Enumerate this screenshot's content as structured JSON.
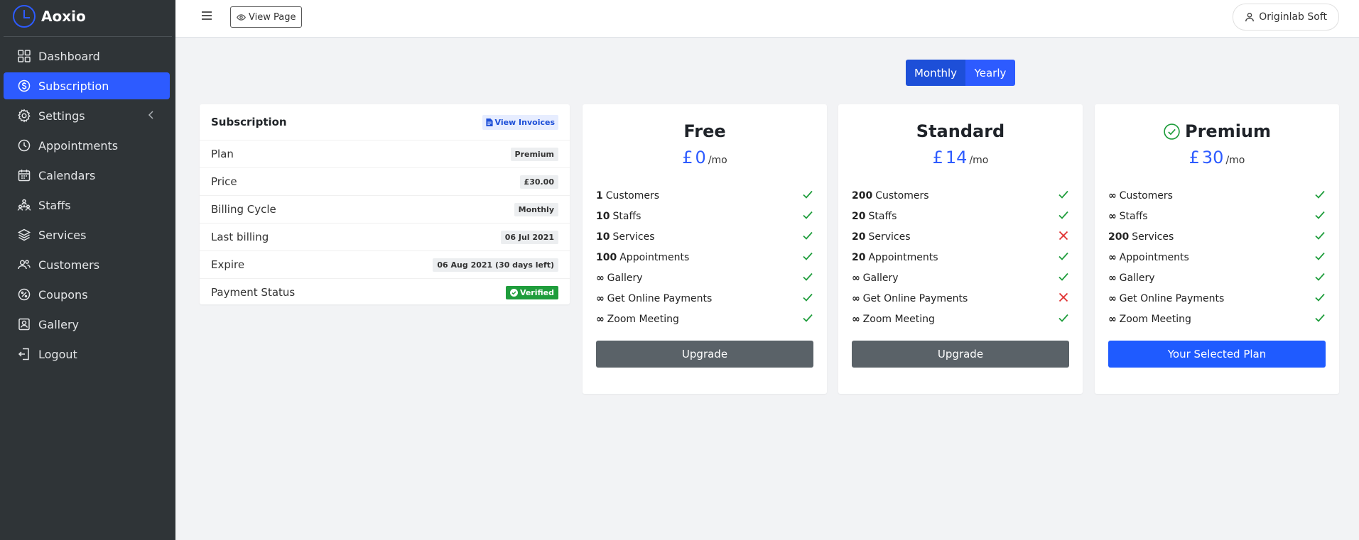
{
  "app": {
    "name": "Aoxio"
  },
  "sidebar": {
    "items": [
      {
        "label": "Dashboard",
        "icon": "grid-icon",
        "active": false
      },
      {
        "label": "Subscription",
        "icon": "dollar-circle-icon",
        "active": true
      },
      {
        "label": "Settings",
        "icon": "gear-icon",
        "active": false
      },
      {
        "label": "Appointments",
        "icon": "clock-icon",
        "active": false
      },
      {
        "label": "Calendars",
        "icon": "calendar-icon",
        "active": false
      },
      {
        "label": "Staffs",
        "icon": "staff-icon",
        "active": false
      },
      {
        "label": "Services",
        "icon": "layers-icon",
        "active": false
      },
      {
        "label": "Customers",
        "icon": "users-icon",
        "active": false
      },
      {
        "label": "Coupons",
        "icon": "coupon-icon",
        "active": false
      },
      {
        "label": "Gallery",
        "icon": "gallery-icon",
        "active": false
      },
      {
        "label": "Logout",
        "icon": "logout-icon",
        "active": false
      }
    ]
  },
  "topbar": {
    "view_page_label": "View Page",
    "user_label": "Originlab Soft"
  },
  "billing_toggle": {
    "monthly": "Monthly",
    "yearly": "Yearly",
    "selected": "Monthly"
  },
  "subscription": {
    "title": "Subscription",
    "invoices_label": "View Invoices",
    "rows": [
      {
        "label": "Plan",
        "value": "Premium"
      },
      {
        "label": "Price",
        "value": "£30.00"
      },
      {
        "label": "Billing Cycle",
        "value": "Monthly"
      },
      {
        "label": "Last billing",
        "value": "06 Jul 2021"
      },
      {
        "label": "Expire",
        "value": "06 Aug 2021 (30 days left)"
      },
      {
        "label": "Payment Status",
        "value": "Verified"
      }
    ]
  },
  "plans": [
    {
      "name": "Free",
      "currency": "£",
      "amount": "0",
      "period": "/mo",
      "selected": false,
      "button": "Upgrade",
      "features": [
        {
          "value": "1",
          "label": "Customers",
          "included": true
        },
        {
          "value": "10",
          "label": "Staffs",
          "included": true
        },
        {
          "value": "10",
          "label": "Services",
          "included": true
        },
        {
          "value": "100",
          "label": "Appointments",
          "included": true
        },
        {
          "value": "∞",
          "label": "Gallery",
          "included": true
        },
        {
          "value": "∞",
          "label": "Get Online Payments",
          "included": true
        },
        {
          "value": "∞",
          "label": "Zoom Meeting",
          "included": true
        }
      ]
    },
    {
      "name": "Standard",
      "currency": "£",
      "amount": "14",
      "period": "/mo",
      "selected": false,
      "button": "Upgrade",
      "features": [
        {
          "value": "200",
          "label": "Customers",
          "included": true
        },
        {
          "value": "20",
          "label": "Staffs",
          "included": true
        },
        {
          "value": "20",
          "label": "Services",
          "included": false
        },
        {
          "value": "20",
          "label": "Appointments",
          "included": true
        },
        {
          "value": "∞",
          "label": "Gallery",
          "included": true
        },
        {
          "value": "∞",
          "label": "Get Online Payments",
          "included": false
        },
        {
          "value": "∞",
          "label": "Zoom Meeting",
          "included": true
        }
      ]
    },
    {
      "name": "Premium",
      "currency": "£",
      "amount": "30",
      "period": "/mo",
      "selected": true,
      "button": "Your Selected Plan",
      "features": [
        {
          "value": "∞",
          "label": "Customers",
          "included": true
        },
        {
          "value": "∞",
          "label": "Staffs",
          "included": true
        },
        {
          "value": "200",
          "label": "Services",
          "included": true
        },
        {
          "value": "∞",
          "label": "Appointments",
          "included": true
        },
        {
          "value": "∞",
          "label": "Gallery",
          "included": true
        },
        {
          "value": "∞",
          "label": "Get Online Payments",
          "included": true
        },
        {
          "value": "∞",
          "label": "Zoom Meeting",
          "included": true
        }
      ]
    }
  ],
  "colors": {
    "sidebar_bg": "#2f3437",
    "accent": "#2d5bff",
    "success": "#1f9d3c",
    "danger": "#e03131",
    "upgrade_button": "#5a6268"
  }
}
